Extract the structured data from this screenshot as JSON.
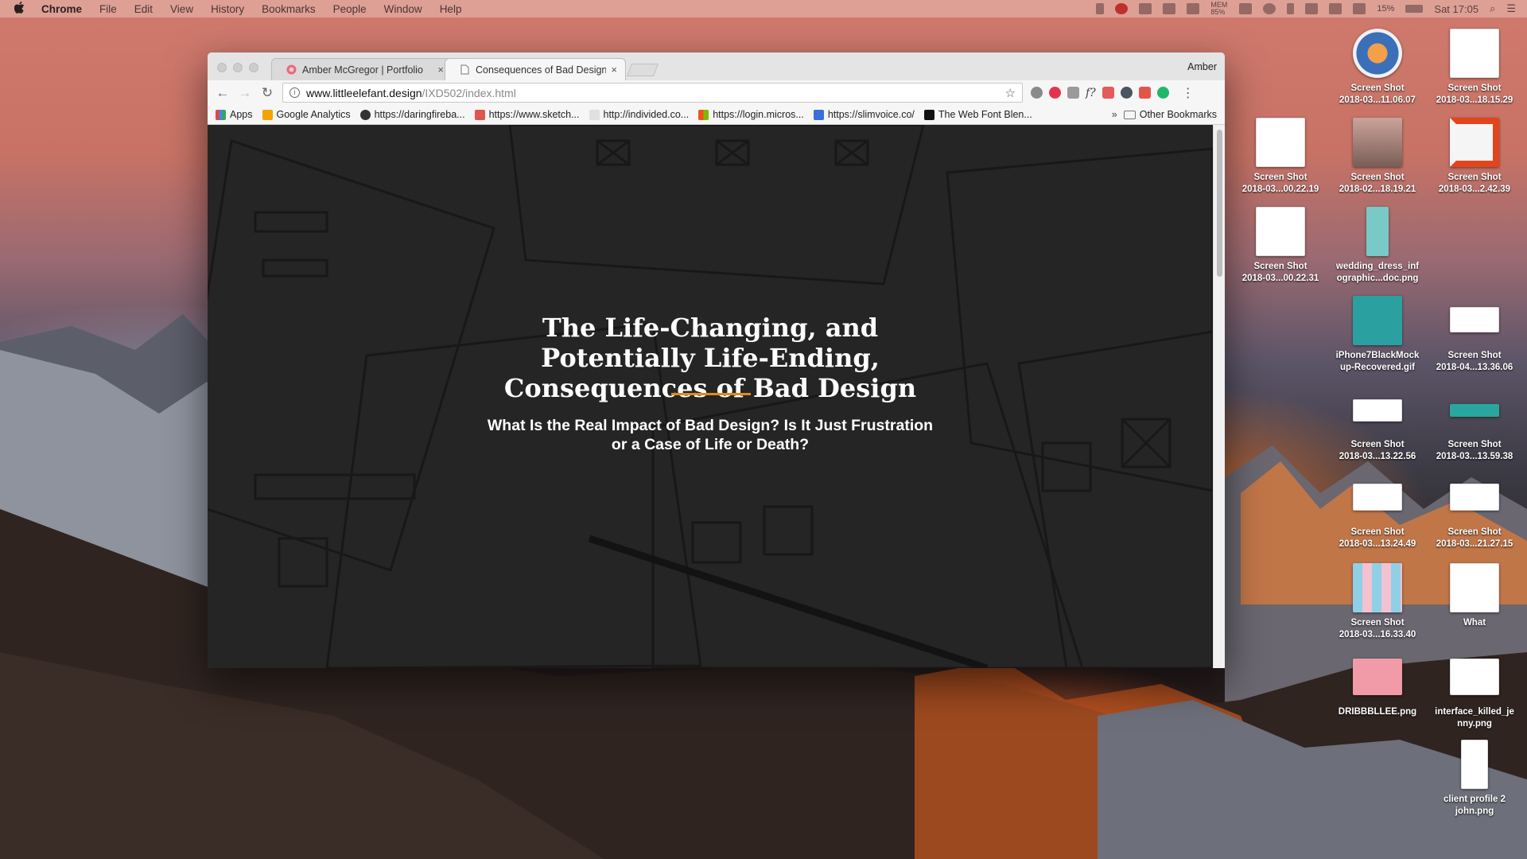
{
  "menubar": {
    "apple": "",
    "items": [
      "Chrome",
      "File",
      "Edit",
      "View",
      "History",
      "Bookmarks",
      "People",
      "Window",
      "Help"
    ],
    "status": {
      "battery": "15%",
      "clock": "Sat 17:05",
      "mem": "MEM 85%"
    }
  },
  "browser": {
    "profile": "Amber",
    "tabs": [
      {
        "title": "Amber McGregor | Portfolio",
        "close": "×"
      },
      {
        "title": "Consequences of Bad Design",
        "close": "×"
      }
    ],
    "url": {
      "host": "www.littleelefant.design",
      "path": "/IXD502/index.html"
    },
    "bookmarks": [
      {
        "label": "Apps",
        "icon": "apps-grid-icon",
        "color": "#e8453c"
      },
      {
        "label": "Google Analytics",
        "icon": "analytics-icon",
        "color": "#f4a300"
      },
      {
        "label": "https://daringfireba...",
        "icon": "star-badge-icon",
        "color": "#333333"
      },
      {
        "label": "https://www.sketch...",
        "icon": "s-icon",
        "color": "#e2554e"
      },
      {
        "label": "http://individed.co...",
        "icon": "blank-icon",
        "color": "#e0e0e0"
      },
      {
        "label": "https://login.micros...",
        "icon": "microsoft-icon",
        "color": "#f25022"
      },
      {
        "label": "https://slimvoice.co/",
        "icon": "slimvoice-icon",
        "color": "#3a6fd8"
      },
      {
        "label": "The Web Font Blen...",
        "icon": "b-icon",
        "color": "#111111"
      }
    ],
    "bookmarks_more": "»",
    "other_bookmarks": "Other Bookmarks"
  },
  "page": {
    "title": "The Life-Changing, and Potentially Life-Ending, Consequences of Bad Design",
    "subtitle": "What Is the Real Impact of Bad Design? Is It Just Frustration or a Case of Life or Death?",
    "accent": "#e08a1e"
  },
  "desktop": {
    "icons": [
      {
        "line1": "Screen Shot",
        "line2": "2018-03...11.06.07"
      },
      {
        "line1": "Screen Shot",
        "line2": "2018-03...18.15.29"
      },
      {
        "line1": "Screen Shot",
        "line2": "2018-03...00.22.19"
      },
      {
        "line1": "Screen Shot",
        "line2": "2018-02...18.19.21"
      },
      {
        "line1": "Screen Shot",
        "line2": "2018-03...2.42.39"
      },
      {
        "line1": "Screen Shot",
        "line2": "2018-03...00.22.31"
      },
      {
        "line1": "wedding_dress_inf",
        "line2": "ographic...doc.png"
      },
      {
        "line1": "iPhone7BlackMock",
        "line2": "up-Recovered.gif"
      },
      {
        "line1": "Screen Shot",
        "line2": "2018-04...13.36.06"
      },
      {
        "line1": "Screen Shot",
        "line2": "2018-03...13.22.56"
      },
      {
        "line1": "Screen Shot",
        "line2": "2018-03...13.59.38"
      },
      {
        "line1": "Screen Shot",
        "line2": "2018-03...13.24.49"
      },
      {
        "line1": "Screen Shot",
        "line2": "2018-03...21.27.15"
      },
      {
        "line1": "Screen Shot",
        "line2": "2018-03...16.33.40"
      },
      {
        "line1": "What",
        "line2": ""
      },
      {
        "line1": "DRIBBBLLEE.png",
        "line2": ""
      },
      {
        "line1": "interface_killed_je",
        "line2": "nny.png"
      },
      {
        "line1": "client profile 2",
        "line2": "john.png"
      }
    ]
  }
}
